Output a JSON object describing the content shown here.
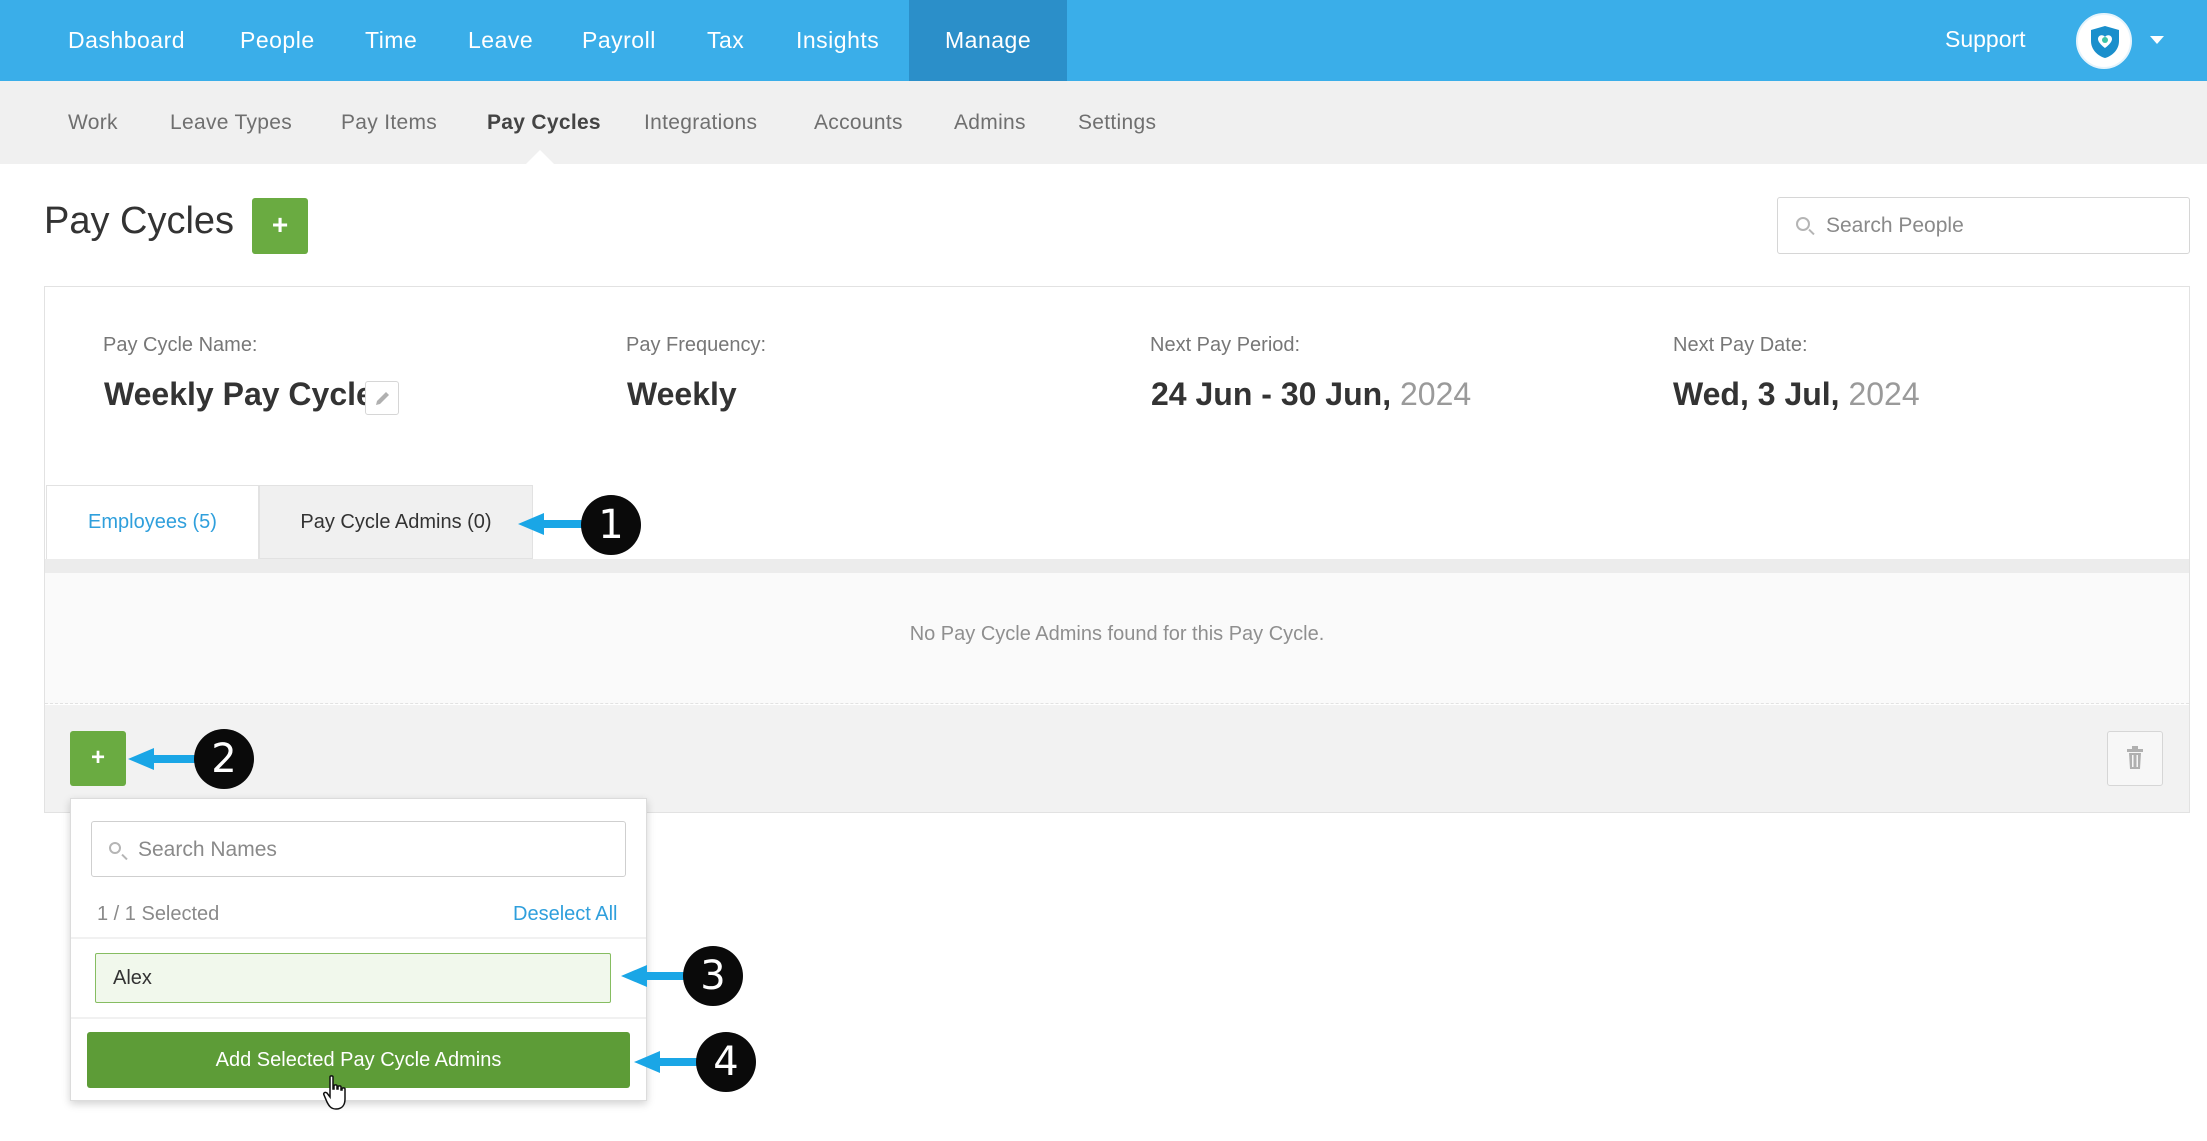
{
  "topnav": {
    "items": [
      "Dashboard",
      "People",
      "Time",
      "Leave",
      "Payroll",
      "Tax",
      "Insights",
      "Manage"
    ],
    "active": "Manage",
    "support": "Support"
  },
  "subnav": {
    "items": [
      "Work",
      "Leave Types",
      "Pay Items",
      "Pay Cycles",
      "Integrations",
      "Accounts",
      "Admins",
      "Settings"
    ],
    "active": "Pay Cycles"
  },
  "page": {
    "title": "Pay Cycles",
    "add_label": "+",
    "search_placeholder": "Search People"
  },
  "details": {
    "name_label": "Pay Cycle Name:",
    "name_value": "Weekly Pay Cycle",
    "frequency_label": "Pay Frequency:",
    "frequency_value": "Weekly",
    "period_label": "Next Pay Period:",
    "period_value": "24 Jun - 30 Jun,",
    "period_year": "2024",
    "date_label": "Next Pay Date:",
    "date_value": "Wed, 3 Jul,",
    "date_year": "2024"
  },
  "tabs": {
    "employees": "Employees (5)",
    "admins": "Pay Cycle Admins (0)"
  },
  "empty_message": "No Pay Cycle Admins found for this Pay Cycle.",
  "footer": {
    "add_label": "+"
  },
  "dropdown": {
    "search_placeholder": "Search Names",
    "selected_count": "1 / 1 Selected",
    "deselect_all": "Deselect All",
    "options": [
      "Alex"
    ],
    "submit_label": "Add Selected Pay Cycle Admins"
  },
  "annotations": [
    "1",
    "2",
    "3",
    "4"
  ],
  "colors": {
    "topnav": "#3aaee9",
    "topnav_active": "#2b8fc9",
    "green": "#6aab41",
    "link": "#2f9fdc",
    "arrow": "#1aa6e6"
  }
}
